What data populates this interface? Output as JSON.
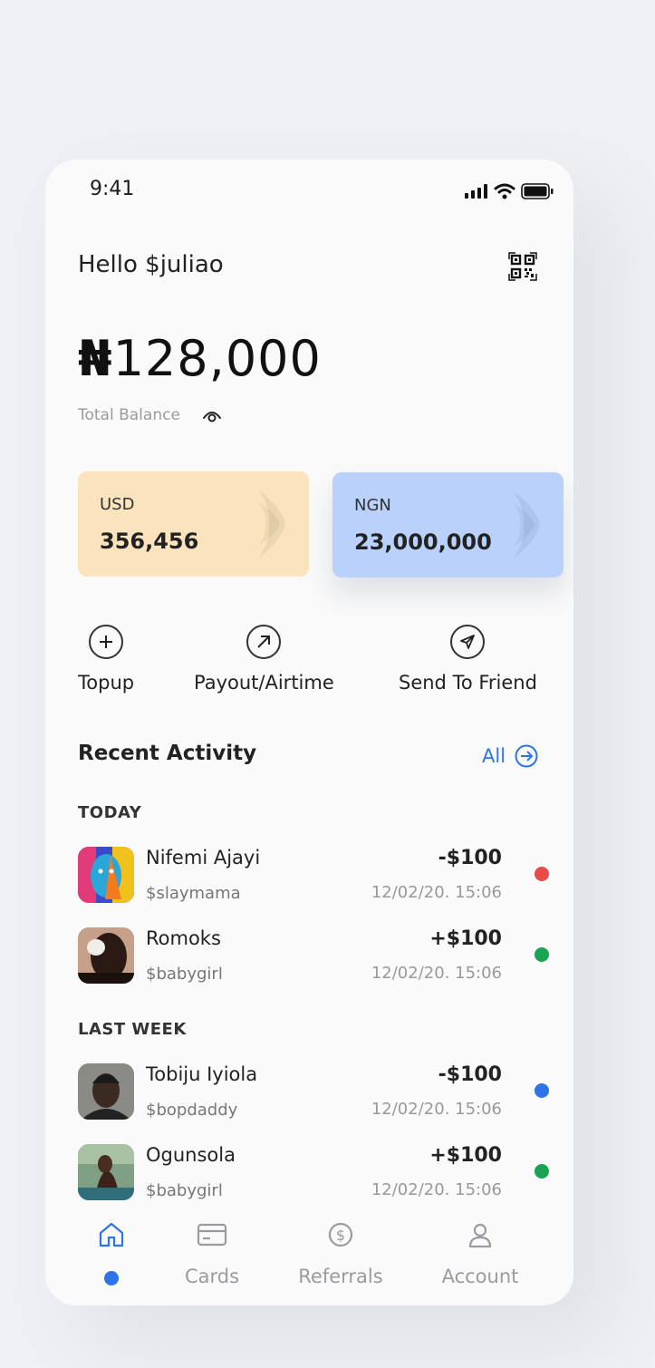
{
  "status": {
    "time": "9:41"
  },
  "header": {
    "greeting": "Hello $juliao"
  },
  "balance": {
    "currency_symbol": "₦",
    "amount": "128,000",
    "label": "Total Balance"
  },
  "wallets": [
    {
      "code": "USD",
      "amount": "356,456",
      "color": "#fbe4bd"
    },
    {
      "code": "NGN",
      "amount": "23,000,000",
      "color": "#b9d1fb"
    }
  ],
  "actions": [
    {
      "label": "Topup",
      "icon": "plus-icon"
    },
    {
      "label": "Payout/Airtime",
      "icon": "arrow-up-right-icon"
    },
    {
      "label": "Send To Friend",
      "icon": "send-icon"
    }
  ],
  "activity": {
    "title": "Recent Activity",
    "all_label": "All",
    "groups": [
      {
        "label": "TODAY",
        "items": [
          {
            "name": "Nifemi Ajayi",
            "handle": "$slaymama",
            "amount": "-$100",
            "date": "12/02/20. 15:06",
            "status_color": "#e84a4a"
          },
          {
            "name": "Romoks",
            "handle": "$babygirl",
            "amount": "+$100",
            "date": "12/02/20. 15:06",
            "status_color": "#1aa352"
          }
        ]
      },
      {
        "label": "LAST WEEK",
        "items": [
          {
            "name": "Tobiju Iyiola",
            "handle": "$bopdaddy",
            "amount": "-$100",
            "date": "12/02/20. 15:06",
            "status_color": "#2f74e6"
          },
          {
            "name": "Ogunsola",
            "handle": "$babygirl",
            "amount": "+$100",
            "date": "12/02/20. 15:06",
            "status_color": "#1aa352"
          }
        ]
      }
    ]
  },
  "nav": {
    "accent": "#2f74e6",
    "items": [
      {
        "label": "",
        "icon": "home-icon",
        "active": true
      },
      {
        "label": "Cards",
        "icon": "card-icon"
      },
      {
        "label": "Referrals",
        "icon": "dollar-icon"
      },
      {
        "label": "Account",
        "icon": "user-icon"
      }
    ]
  }
}
